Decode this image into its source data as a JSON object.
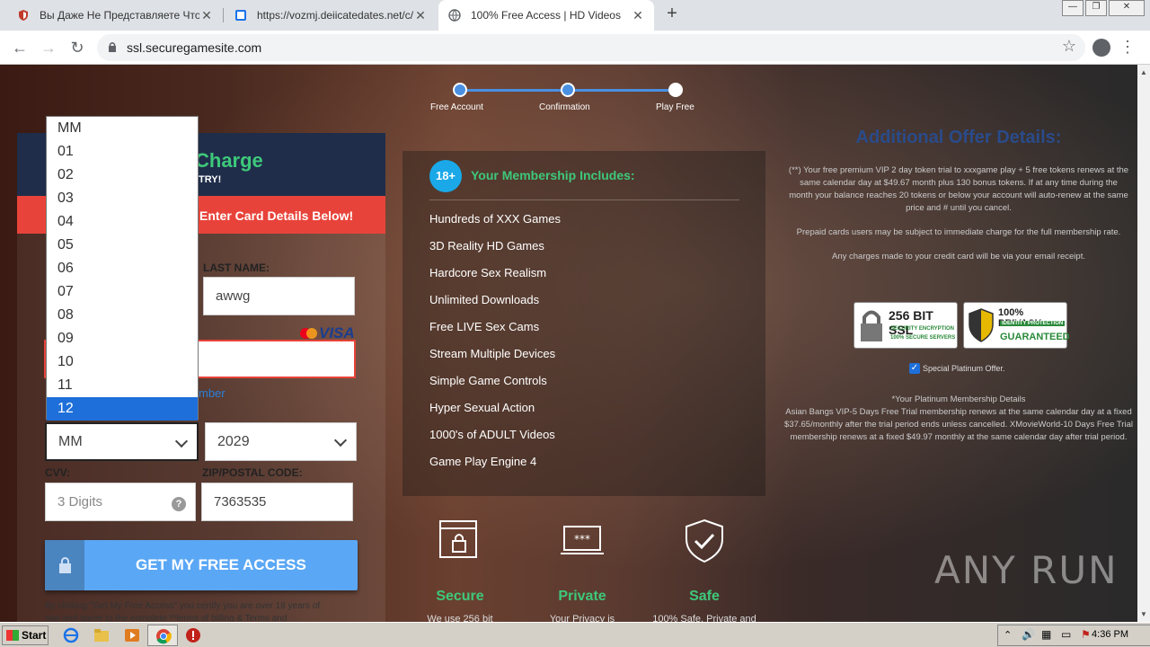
{
  "browser": {
    "tabs": [
      {
        "title": "Вы Даже Не Представляете Что М",
        "close": "✕"
      },
      {
        "title": "https://vozmj.deiicatedates.net/c/d",
        "close": "✕"
      },
      {
        "title": "100% Free Access | HD Videos",
        "close": "✕"
      }
    ],
    "new_tab": "+",
    "url": "ssl.securegamesite.com",
    "window_controls": [
      "—",
      "❐",
      "✕"
    ]
  },
  "steps": [
    "Free Account",
    "Confirmation",
    "Play Free"
  ],
  "form": {
    "header_title": "Charge",
    "header_sub": "TRY!",
    "red_bar": "Enter Card Details Below!",
    "last_name_label": "LAST NAME:",
    "last_name_value": "awwg",
    "card_brand": "VISA",
    "link_text": "mber",
    "month_value": "MM",
    "year_value": "2029",
    "cvv_label": "CVV:",
    "cvv_placeholder": "3 Digits",
    "zip_label": "ZIP/POSTAL CODE:",
    "zip_value": "7363535",
    "cta": "GET MY FREE ACCESS",
    "legal_line1": "By clicking \"Get My Free Access\" you certify you are over 18 years of",
    "legal_line2": "age and agree to the complete **terms of billing & Terms and"
  },
  "dropdown": {
    "options": [
      "MM",
      "01",
      "02",
      "03",
      "04",
      "05",
      "06",
      "07",
      "08",
      "09",
      "10",
      "11",
      "12"
    ],
    "selected": "12"
  },
  "membership": {
    "badge": "18+",
    "title": "Your Membership Includes:",
    "items": [
      "Hundreds of XXX Games",
      "3D Reality HD Games",
      "Hardcore Sex Realism",
      "Unlimited Downloads",
      "Free LIVE Sex Cams",
      "Stream Multiple Devices",
      "Simple Game Controls",
      "Hyper Sexual Action",
      "1000's of ADULT Videos",
      "Game Play Engine 4"
    ]
  },
  "features": [
    {
      "title": "Secure",
      "desc": "We use 256 bit"
    },
    {
      "title": "Private",
      "desc": "Your Privacy is"
    },
    {
      "title": "Safe",
      "desc": "100% Safe, Private and"
    }
  ],
  "offer": {
    "title": "Additional Offer Details:",
    "p1": "(**) Your free premium VIP 2 day token trial to xxxgame play + 5 free tokens renews at the same calendar day at $49.67 month plus 130 bonus tokens. If at any time during the month your balance reaches 20 tokens or below your account will auto-renew at the same price and # until you cancel.",
    "p2": "Prepaid cards users may be subject to immediate charge for the full membership rate.",
    "p3": "Any charges made to your credit card will be via your email receipt.",
    "seal1_big": "256 BIT SSL",
    "seal1_small1": "SECURITY ENCRYPTION",
    "seal1_small2": "100% SECURE SERVERS",
    "seal2_big": "100% PRIVACY",
    "seal2_small": "IDENTITY PROTECTION",
    "seal2_guar": "GUARANTEED",
    "checkbox_label": "Special Platinum Offer.",
    "p4": "*Your Platinum Membership Details",
    "p5": "Asian Bangs VIP-5 Days Free Trial membership renews at the same calendar day at a fixed $37.65/monthly after the trial period ends unless cancelled. XMovieWorld-10 Days Free Trial membership renews at a fixed $49.97 monthly at the same calendar day after trial period."
  },
  "watermark": "ANY RUN",
  "taskbar": {
    "start": "Start",
    "time": "4:36 PM"
  }
}
